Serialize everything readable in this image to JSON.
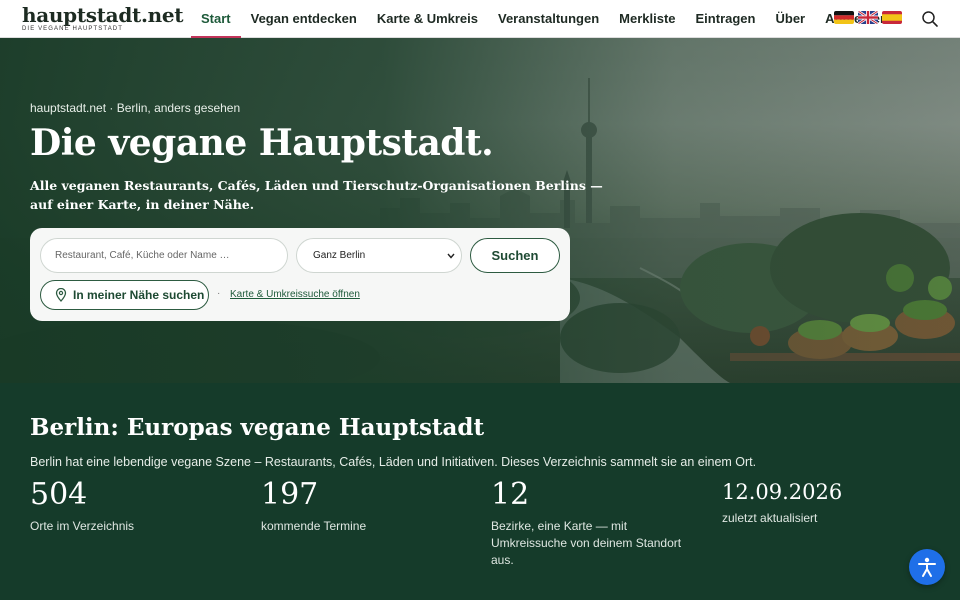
{
  "brand": {
    "name": "hauptstadt.net",
    "tagline": "DIE VEGANE HAUPTSTADT"
  },
  "nav": {
    "items": [
      {
        "label": "Start",
        "active": true
      },
      {
        "label": "Vegan entdecken"
      },
      {
        "label": "Karte & Umkreis"
      },
      {
        "label": "Veranstaltungen"
      },
      {
        "label": "Merkliste"
      },
      {
        "label": "Eintragen"
      },
      {
        "label": "Über"
      },
      {
        "label": "Anmelden"
      }
    ],
    "languages": [
      "de",
      "en",
      "es"
    ],
    "search_icon": "search-icon"
  },
  "hero": {
    "eyebrow": "hauptstadt.net · Berlin, anders gesehen",
    "title": "Die vegane Hauptstadt.",
    "subtitle": "Alle veganen Restaurants, Cafés, Läden und Tierschutz-Organisationen Berlins — auf einer Karte, in deiner Nähe.",
    "search": {
      "placeholder": "Restaurant, Café, Küche oder Name …",
      "district_selected": "Ganz Berlin",
      "submit_label": "Suchen",
      "nearby_label": "In meiner Nähe suchen",
      "separator": "·",
      "map_link_label": "Karte & Umkreissuche öffnen"
    }
  },
  "stats": {
    "title": "Berlin: Europas vegane Hauptstadt",
    "intro": "Berlin hat eine lebendige vegane Szene – Restaurants, Cafés, Läden und Initiativen. Dieses Verzeichnis sammelt sie an einem Ort.",
    "items": [
      {
        "value": "504",
        "label": "Orte im Verzeichnis"
      },
      {
        "value": "197",
        "label": "kommende Termine"
      },
      {
        "value": "12",
        "label": "Bezirke, eine Karte — mit Umkreissuche von deinem Standort aus."
      },
      {
        "value": "12.09.2026",
        "label": "zuletzt aktualisiert"
      }
    ]
  },
  "colors": {
    "accent_green": "#153b2a",
    "active_underline": "#c2345a",
    "a11y_blue": "#1f6fe8"
  }
}
